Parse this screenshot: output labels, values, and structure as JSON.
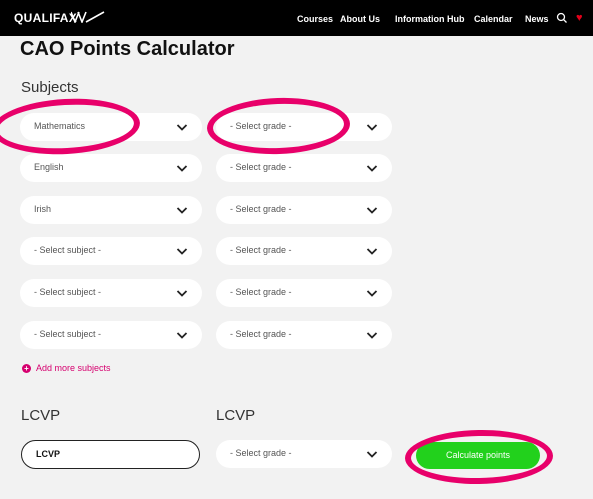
{
  "header": {
    "logo": "QUALIFAX",
    "nav": [
      {
        "label": "Courses"
      },
      {
        "label": "About Us"
      },
      {
        "label": "Information Hub"
      },
      {
        "label": "Calendar"
      },
      {
        "label": "News"
      }
    ],
    "colors": {
      "bar": "#000000",
      "heart": "#e2001a"
    }
  },
  "page": {
    "title": "CAO Points Calculator",
    "subjects_heading": "Subjects",
    "rows": [
      {
        "subject": "Mathematics",
        "grade": "- Select grade -"
      },
      {
        "subject": "English",
        "grade": "- Select grade -"
      },
      {
        "subject": "Irish",
        "grade": "- Select grade -"
      },
      {
        "subject": "- Select subject -",
        "grade": "- Select grade -"
      },
      {
        "subject": "- Select subject -",
        "grade": "- Select grade -"
      },
      {
        "subject": "- Select subject -",
        "grade": "- Select grade -"
      }
    ],
    "add_more": "Add more subjects",
    "lcvp_heading_left": "LCVP",
    "lcvp_heading_right": "LCVP",
    "lcvp_value": "LCVP",
    "lcvp_grade": "- Select grade -",
    "calculate_label": "Calculate points",
    "colors": {
      "accent": "#d6006f",
      "button": "#22d11c",
      "annotation": "#e8006a"
    }
  }
}
